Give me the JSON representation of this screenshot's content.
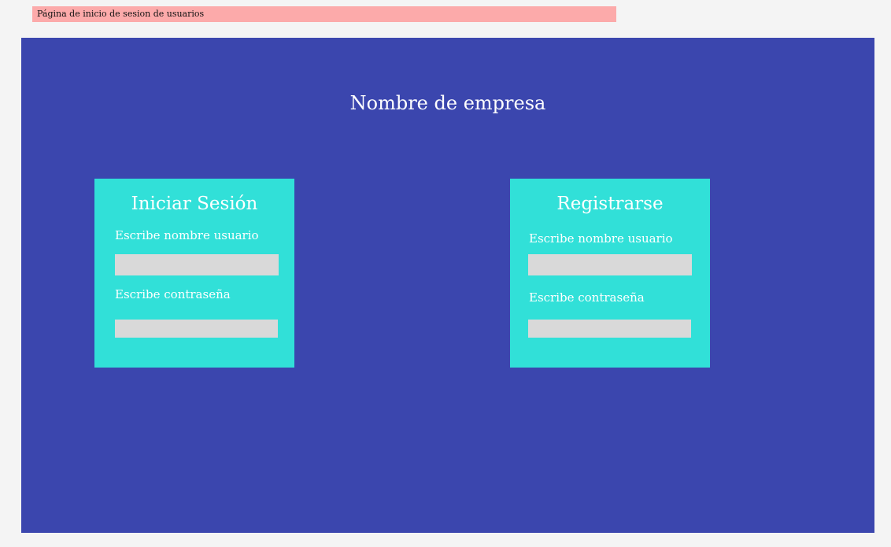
{
  "page_label": "Página de inicio de sesion de usuarios",
  "company_name": "Nombre de empresa",
  "login": {
    "title": "Iniciar Sesión",
    "username_label": "Escribe nombre usuario",
    "username_value": "",
    "password_label": "Escribe contraseña",
    "password_value": ""
  },
  "register": {
    "title": "Registrarse",
    "username_label": "Escribe nombre usuario",
    "username_value": "",
    "password_label": "Escribe contraseña",
    "password_value": ""
  },
  "colors": {
    "background": "#f4f4f4",
    "page_label_bg": "#fcaaaa",
    "main_panel": "#3b46ae",
    "card": "#31e0d8",
    "input": "#d9d9d9",
    "text_light": "#ffffff"
  }
}
